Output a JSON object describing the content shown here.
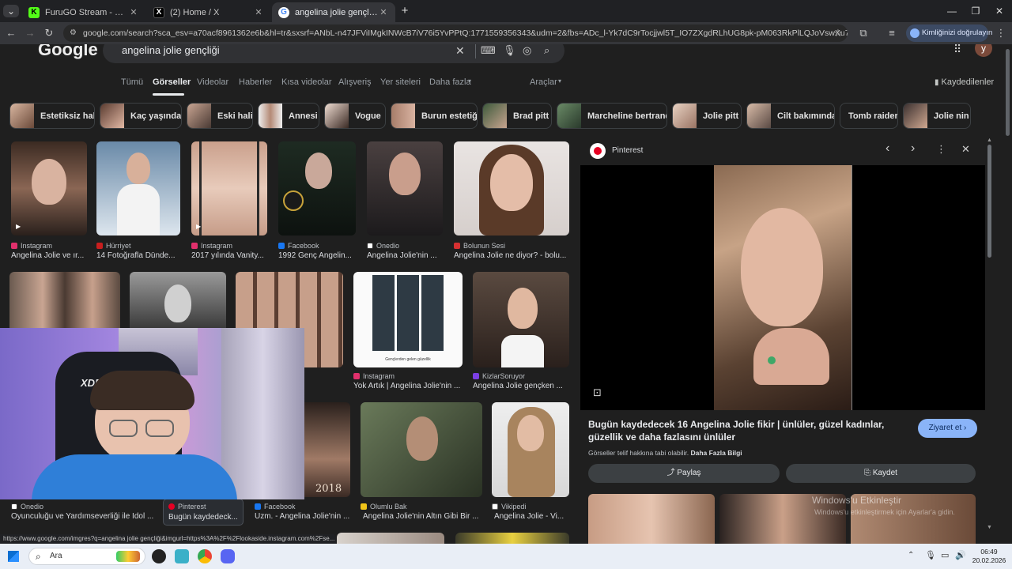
{
  "tabs": [
    {
      "title": "FuruGO Stream - Watch Live or",
      "icon": "kick-icon",
      "active": false
    },
    {
      "title": "(2) Home / X",
      "icon": "x-icon",
      "active": false
    },
    {
      "title": "angelina jolie gençliği - Google",
      "icon": "google-icon",
      "active": true
    }
  ],
  "toolbar": {
    "url": "google.com/search?sca_esv=a70acf8961362e6b&hl=tr&sxsrf=ANbL-n47JFViIMgkINWcB7iV76i5YvPPtQ:1771559356343&udm=2&fbs=ADc_l-Yk7dC9rTocjjwl5T_IO7ZXgdRLhUG8pk-pM063RkPlLQJoVswXu7XoIdd5UH6fMlq_s9nb...",
    "identity_button": "Kimliğinizi doğrulayın",
    "profile_initial": "y"
  },
  "search": {
    "logo": "Google",
    "query": "angelina jolie gençliği"
  },
  "nav": {
    "tabs": [
      "Tümü",
      "Görseller",
      "Videolar",
      "Haberler",
      "Kısa videolar",
      "Alışveriş",
      "Yer siteleri",
      "Daha fazla",
      "Araçlar"
    ],
    "saved": "Kaydedilenler"
  },
  "chips": [
    "Estetiksiz hali",
    "Kaç yaşında",
    "Eski hali",
    "Annesi",
    "Vogue",
    "Burun estetiği",
    "Brad pitt",
    "Marcheline bertrand",
    "Jolie pitt",
    "Cilt bakımında",
    "Tomb raider",
    "Jolie nin"
  ],
  "results": {
    "row1": [
      {
        "source": "Instagram",
        "title": "Angelina Jolie ve ır..."
      },
      {
        "source": "Hürriyet",
        "title": "14 Fotoğrafla Dünde..."
      },
      {
        "source": "Instagram",
        "title": "2017 yılında Vanity..."
      },
      {
        "source": "Facebook",
        "title": "1992 Genç Angelin..."
      },
      {
        "source": "Onedio",
        "title": "Angelina Jolie'nin ..."
      },
      {
        "source": "Bolunun Sesi",
        "title": "Angelina Jolie ne diyor? - bolu..."
      }
    ],
    "row2": [
      {
        "source": "",
        "title": "...oday An..."
      },
      {
        "source": "Instagram",
        "title": "Yok Artık | Angelina Jolie'nin ..."
      },
      {
        "source": "KizlarSoruyor",
        "title": "Angelina Jolie gençken ..."
      }
    ],
    "row3": [
      {
        "source": "Onedio",
        "title": "Oyunculuğu ve Yardımseverliği ile İdol ..."
      },
      {
        "source": "Pinterest",
        "title": "Bugün kaydedeck..."
      },
      {
        "source": "Facebook",
        "title": "Uzm. - Angelina Jolie'nin ..."
      },
      {
        "source": "Olumlu Bak",
        "title": "Angelina Jolie'nin Altın Gibi Bir ..."
      },
      {
        "source": "Vikipedi",
        "title": "Angelina Jolie - Vi..."
      }
    ],
    "collage_caption": "Gençlerden gelen güzellik",
    "year_tag": "2018"
  },
  "panel": {
    "source": "Pinterest",
    "title": "Bugün kaydedecek 16 Angelina Jolie fikir | ünlüler, güzel kadınlar, güzellik ve daha fazlasını ünlüler",
    "visit": "Ziyaret et",
    "copyright": "Görseller telif hakkına tabi olabilir.",
    "more_info": "Daha Fazla Bilgi",
    "share": "Paylaş",
    "save": "Kaydet"
  },
  "watermark": {
    "line1": "Windows'u Etkinleştir",
    "line2": "Windows'u etkinleştirmek için Ayarlar'a gidin."
  },
  "status_url": "https://www.google.com/imgres?q=angelina jolie gençliği&imgurl=https%3A%2F%2Flookaside.instagram.com%2Fse...",
  "taskbar": {
    "search": "Ara",
    "time": "06:49",
    "date": "20.02.2026"
  },
  "webcam": {
    "chair_brand": "XDRIVE"
  }
}
